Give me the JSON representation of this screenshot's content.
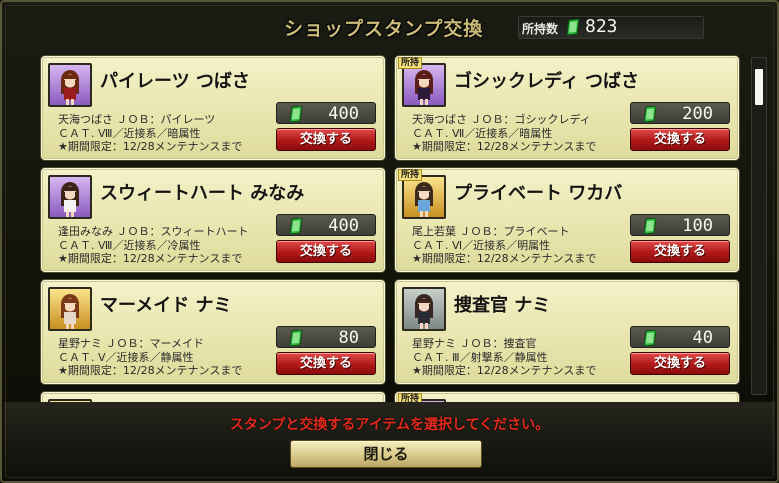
{
  "header": {
    "title": "ショップスタンプ交換",
    "owned_label": "所持数",
    "owned_value": "823"
  },
  "colors": {
    "stamp_green": "#29b53a",
    "exchange_red": "#b01818",
    "card_bg": "#ebe8b4",
    "instruction_red": "#e52a1c"
  },
  "cards": [
    {
      "name": "パイレーツ つばさ",
      "owned_tag": "",
      "portrait_icon": "character-tsubasa-pirates-icon",
      "info1": "天海つばさ ＪＯＢ：パイレーツ",
      "info2": "ＣＡＴ. Ⅷ／近接系／暗属性",
      "info3": "★期間限定：12/28メンテナンスまで",
      "price": "400",
      "button": "交換する"
    },
    {
      "name": "ゴシックレディ つばさ",
      "owned_tag": "所持",
      "portrait_icon": "character-tsubasa-gothic-icon",
      "info1": "天海つばさ ＪＯＢ：ゴシックレディ",
      "info2": "ＣＡＴ. Ⅶ／近接系／暗属性",
      "info3": "★期間限定：12/28メンテナンスまで",
      "price": "200",
      "button": "交換する"
    },
    {
      "name": "スウィートハート みなみ",
      "owned_tag": "",
      "portrait_icon": "character-minami-sweetheart-icon",
      "info1": "逢田みなみ ＪＯＢ：スウィートハート",
      "info2": "ＣＡＴ. Ⅷ／近接系／冷属性",
      "info3": "★期間限定：12/28メンテナンスまで",
      "price": "400",
      "button": "交換する"
    },
    {
      "name": "プライベート ワカバ",
      "owned_tag": "所持",
      "portrait_icon": "character-wakaba-private-icon",
      "info1": "尾上若葉 ＪＯＢ：プライベート",
      "info2": "ＣＡＴ. Ⅵ／近接系／明属性",
      "info3": "★期間限定：12/28メンテナンスまで",
      "price": "100",
      "button": "交換する"
    },
    {
      "name": "マーメイド ナミ",
      "owned_tag": "",
      "portrait_icon": "character-nami-mermaid-icon",
      "info1": "星野ナミ ＪＯＢ：マーメイド",
      "info2": "ＣＡＴ. Ⅴ／近接系／静属性",
      "info3": "★期間限定：12/28メンテナンスまで",
      "price": "80",
      "button": "交換する"
    },
    {
      "name": "捜査官 ナミ",
      "owned_tag": "",
      "portrait_icon": "character-nami-investigator-icon",
      "info1": "星野ナミ ＪＯＢ：捜査官",
      "info2": "ＣＡＴ. Ⅲ／射撃系／静属性",
      "info3": "★期間限定：12/28メンテナンスまで",
      "price": "40",
      "button": "交換する"
    },
    {
      "name": "",
      "owned_tag": "",
      "portrait_icon": "character-icon",
      "info1": "",
      "info2": "",
      "info3": "",
      "price": "",
      "button": ""
    },
    {
      "name": "",
      "owned_tag": "所持",
      "portrait_icon": "character-icon",
      "info1": "",
      "info2": "",
      "info3": "",
      "price": "",
      "button": ""
    }
  ],
  "footer": {
    "instruction": "スタンプと交換するアイテムを選択してください。",
    "close_label": "閉じる"
  }
}
